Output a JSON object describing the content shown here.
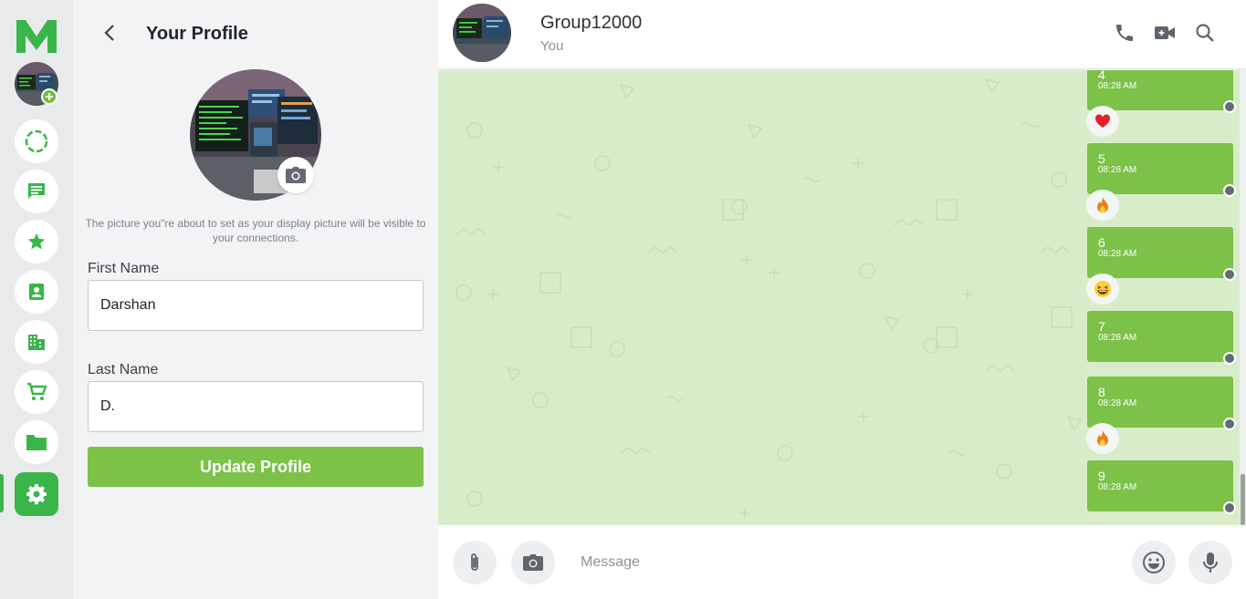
{
  "colors": {
    "brand_green": "#3ab54a",
    "bubble_green": "#7cc148",
    "chat_background": "#d8ecca",
    "rail_background": "#e9eaec"
  },
  "app": {
    "logo_letter": "M"
  },
  "rail": {
    "avatar": {
      "icon": "user-avatar",
      "badge_icon": "plus-icon"
    },
    "items": [
      {
        "id": "status",
        "icon": "status-ring-icon"
      },
      {
        "id": "chats",
        "icon": "chat-icon"
      },
      {
        "id": "starred",
        "icon": "star-icon"
      },
      {
        "id": "contacts",
        "icon": "contacts-icon"
      },
      {
        "id": "business",
        "icon": "building-icon"
      },
      {
        "id": "shop",
        "icon": "cart-icon"
      },
      {
        "id": "files",
        "icon": "folder-icon"
      },
      {
        "id": "settings",
        "icon": "gear-icon",
        "active": true
      }
    ]
  },
  "profile": {
    "title": "Your Profile",
    "picture_note": "The picture you\"re about to set as your display picture will be visible to your connections.",
    "first_name_label": "First Name",
    "first_name_value": "Darshan",
    "last_name_label": "Last Name",
    "last_name_value": "D.",
    "update_button": "Update Profile"
  },
  "chat": {
    "name": "Group12000",
    "subtitle": "You",
    "header_icons": [
      "phone-icon",
      "video-icon",
      "search-icon"
    ],
    "messages": [
      {
        "text": "4",
        "time": "08:28 AM",
        "reaction": "heart"
      },
      {
        "text": "5",
        "time": "08:28 AM",
        "reaction": "fire"
      },
      {
        "text": "6",
        "time": "08:28 AM",
        "reaction": "laughing"
      },
      {
        "text": "7",
        "time": "08:28 AM",
        "reaction": null
      },
      {
        "text": "8",
        "time": "08:28 AM",
        "reaction": "fire"
      },
      {
        "text": "9",
        "time": "08:28 AM",
        "reaction": null
      }
    ]
  },
  "composer": {
    "placeholder": "Message",
    "icons": [
      "paperclip-icon",
      "camera-icon",
      "emoji-icon",
      "microphone-icon"
    ]
  }
}
